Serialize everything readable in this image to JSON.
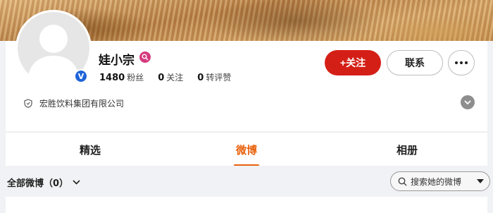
{
  "profile": {
    "name": "娃小宗",
    "verified_mark": "V",
    "stats": [
      {
        "count": "1480",
        "label": "粉丝"
      },
      {
        "count": "0",
        "label": "关注"
      },
      {
        "count": "0",
        "label": "转评赞"
      }
    ],
    "company": "宏胜饮料集团有限公司"
  },
  "actions": {
    "follow_label": "+关注",
    "contact_label": "联系"
  },
  "tabs": [
    {
      "label": "精选",
      "active": false
    },
    {
      "label": "微博",
      "active": true
    },
    {
      "label": "相册",
      "active": false
    }
  ],
  "filter": {
    "all_weibo_label": "全部微博（0）",
    "search_placeholder": "搜索她的微博"
  },
  "colors": {
    "accent": "#e8620e",
    "follow_button": "#d41f17",
    "verified_badge": "#1e63d8"
  },
  "icons": [
    "user-silhouette-icon",
    "verified-v-icon",
    "profile-badge-icon",
    "more-dots-icon",
    "shield-icon",
    "chevron-down-icon",
    "search-icon",
    "dropdown-arrow-icon"
  ]
}
